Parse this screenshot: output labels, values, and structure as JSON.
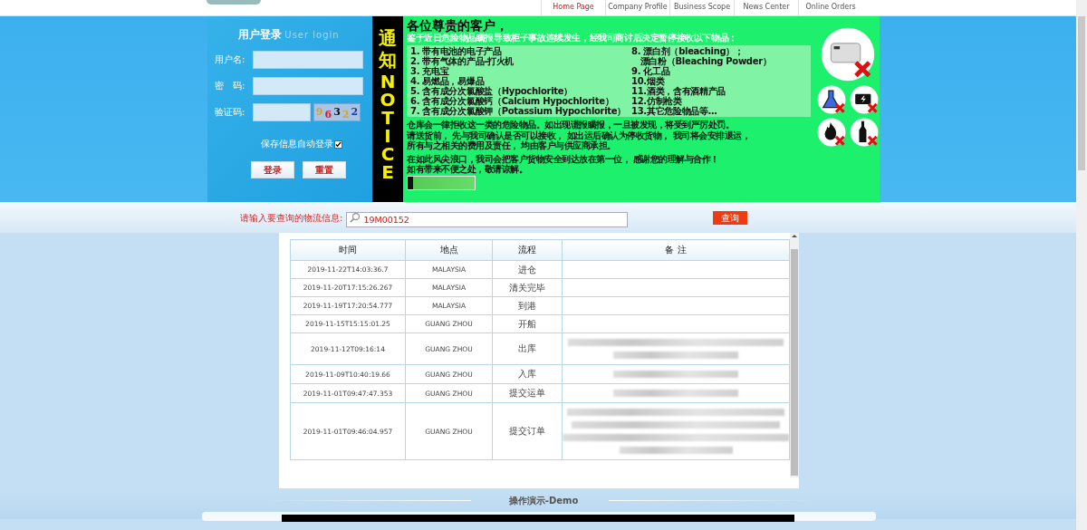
{
  "nav": [
    {
      "label": "Home Page",
      "selected": true
    },
    {
      "label": "Company Profile",
      "selected": false
    },
    {
      "label": "Business Scope",
      "selected": false
    },
    {
      "label": "News Center",
      "selected": false
    },
    {
      "label": "Online Orders",
      "selected": false
    }
  ],
  "login": {
    "title": "用户登录",
    "subtitle": "User login",
    "fields": [
      {
        "label": "用户名:",
        "kind": "text"
      },
      {
        "label": "密　码:",
        "kind": "password"
      },
      {
        "label": "验证码:",
        "kind": "captcha"
      }
    ],
    "captcha": "96322",
    "remember": {
      "label": "保存信息自动登录",
      "checked": true
    },
    "buttons": [
      "登录",
      "重置"
    ]
  },
  "notice": {
    "side_title": "通知",
    "side_en": "NOTICE",
    "greeting": "各位尊贵的客户，",
    "intro": "鉴于近日**危险物品瞒报**导致柜子事故连续发生，经我司商讨后决定暂停接收以下物品：",
    "items_left": [
      "1. 带有电池的电子产品",
      "2. 带有气体的产品-打火机",
      "3. 充电宝",
      "4. 易燃品，易爆品",
      "5. 含有成分次氯酸盐（Hypochlorite）",
      "6. 含有成分次氯酸钙（Calcium Hypochlorite）",
      "7. 含有成分次氯酸钾（Potassium Hypochlorite）"
    ],
    "items_right": [
      "8. 漂白剂（bleaching）；",
      "　漂白粉（Bleaching Powder）",
      "9. 化工品",
      "10.烟类",
      "11.酒类，含有酒精产品",
      "12.仿制枪类",
      "13.其它危险物品等…"
    ],
    "paragraphs": [
      "仓库会一律拒收这一类的危险物品。如出现谎报瞒报，一旦被发现，将受到严厉处罚。",
      "请送货前， 先与我司确认是否可以接收， 如出运后确认为停收货物， 我司将会安排退运，",
      "所有与之相关的费用及责任， 均由客户与供应商承担。",
      "在如此风尖浪口，我司会把客户货物安全到达放在第一位， 感谢您的理解与合作！",
      "如有带来不便之处，敬请谅解。"
    ]
  },
  "search": {
    "label": "请输入要查询的物流信息:",
    "value": "19M00152",
    "button": "查询"
  },
  "table": {
    "columns": [
      "时间",
      "地点",
      "流程",
      "备 注"
    ],
    "rows": [
      {
        "time": "2019-11-22T14:03:36.7",
        "place": "MALAYSIA",
        "step": "进仓",
        "kind": "plain"
      },
      {
        "time": "2019-11-20T17:15:26.267",
        "place": "MALAYSIA",
        "step": "清关完毕",
        "kind": "plain"
      },
      {
        "time": "2019-11-19T17:20:54.777",
        "place": "MALAYSIA",
        "step": "到港",
        "kind": "plain"
      },
      {
        "time": "2019-11-15T15:15:01.25",
        "place": "GUANG ZHOU",
        "step": "开船",
        "kind": "plain"
      },
      {
        "time": "2019-11-12T09:16:14",
        "place": "GUANG ZHOU",
        "step": "出库",
        "kind": "redacted"
      },
      {
        "time": "2019-11-09T10:40:19.66",
        "place": "GUANG ZHOU",
        "step": "入库",
        "kind": "redacted-short"
      },
      {
        "time": "2019-11-01T09:47:47.353",
        "place": "GUANG ZHOU",
        "step": "提交运单",
        "kind": "redacted-short"
      },
      {
        "time": "2019-11-01T09:46:04.957",
        "place": "GUANG ZHOU",
        "step": "提交订单",
        "kind": "redacted-long"
      }
    ]
  },
  "demo": {
    "title": "**操作演示**-Demo"
  }
}
